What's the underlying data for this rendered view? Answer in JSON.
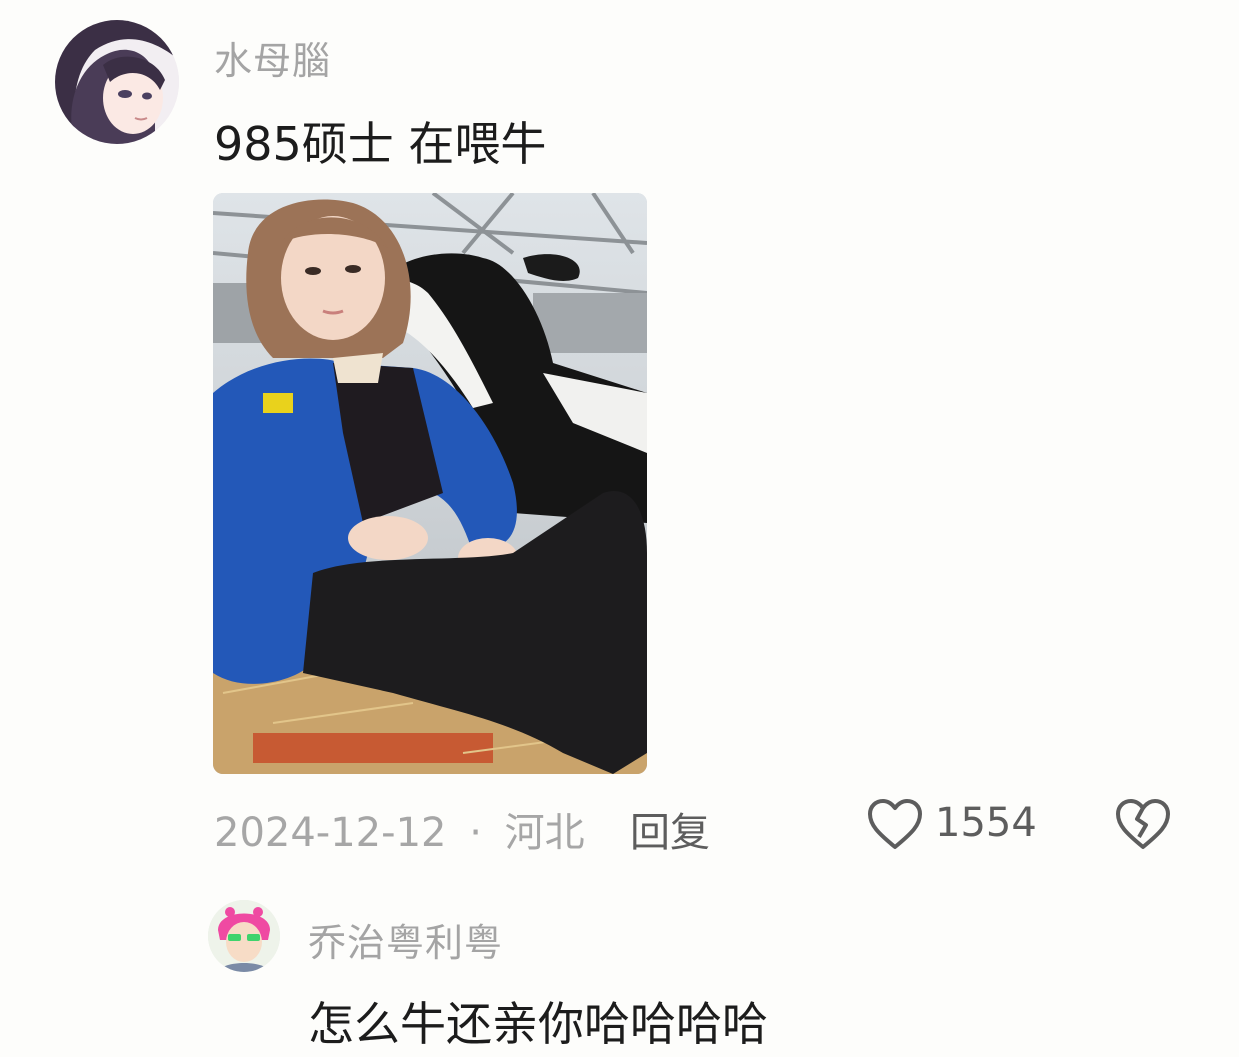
{
  "comment": {
    "username": "水母腦",
    "text": "985硕士 在喂牛",
    "date": "2024-12-12",
    "separator": "·",
    "location": "河北",
    "reply_label": "回复",
    "like_icon": "heart-outline-icon",
    "like_count": "1554",
    "dislike_icon": "broken-heart-icon",
    "image_alt": "photo of woman in blue jacket sitting on straw with a black-and-white calf nuzzling her face"
  },
  "reply": {
    "username": "乔治粤利粤",
    "text": "怎么牛还亲你哈哈哈哈"
  },
  "colors": {
    "background": "#fdfdfb",
    "username": "#a4a4a4",
    "text": "#1c1c1c",
    "action": "#5d5d5d"
  }
}
